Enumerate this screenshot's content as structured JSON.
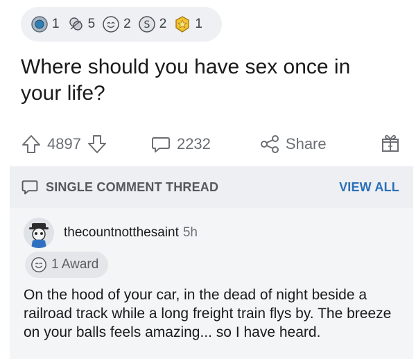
{
  "awards": [
    {
      "icon": "silver-award-icon",
      "count": "1"
    },
    {
      "icon": "hugz-award-icon",
      "count": "5"
    },
    {
      "icon": "wholesome-award-icon",
      "count": "2"
    },
    {
      "icon": "coin-award-icon",
      "count": "2"
    },
    {
      "icon": "gold-award-icon",
      "count": "1"
    }
  ],
  "post": {
    "title": "Where should you have sex once in your life?"
  },
  "actions": {
    "upvotes": "4897",
    "comments": "2232",
    "share_label": "Share"
  },
  "thread": {
    "label": "SINGLE COMMENT THREAD",
    "view_all": "VIEW ALL"
  },
  "comment": {
    "username": "thecountnotthesaint",
    "time": "5h",
    "award_label": "1 Award",
    "body": "On the hood of your car, in the dead of night beside a railroad track while a long freight train flys by. The breeze on your balls feels amazing... so I have heard."
  },
  "colors": {
    "accent": "#2a6fb8",
    "muted": "#6b6e73"
  }
}
